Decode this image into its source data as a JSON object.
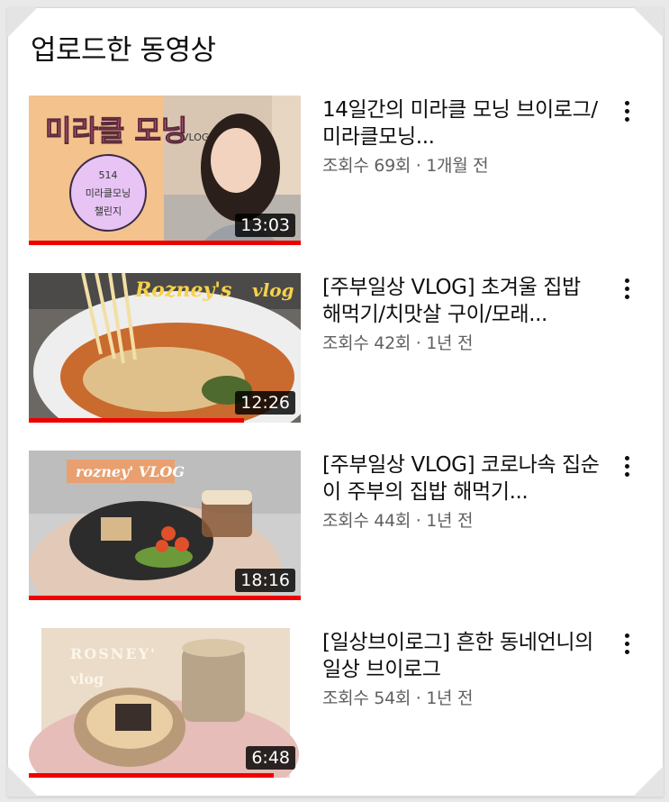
{
  "section": {
    "title": "업로드한 동영상"
  },
  "colors": {
    "progress": "#ee0000",
    "text": "#0f0f0f",
    "meta": "#606060"
  },
  "videos": [
    {
      "title": "14일간의 미라클 모닝 브이로그/미라클모닝...",
      "meta": "조회수 69회 · 1개월 전",
      "duration": "13:03",
      "watched": 1.0,
      "thumb_text": {
        "main": "미라클 모닝",
        "vlog": "VLOG",
        "circle1": "514",
        "circle2": "미라클모닝",
        "circle3": "챌린지"
      }
    },
    {
      "title": "[주부일상 VLOG] 초겨울 집밥 해먹기/치맛살 구이/모래...",
      "meta": "조회수 42회 · 1년 전",
      "duration": "12:26",
      "watched": 0.79,
      "thumb_text": {
        "main": "Rozney's",
        "vlog": "vlog"
      }
    },
    {
      "title": "[주부일상 VLOG] 코로나속 집순이 주부의 집밥 해먹기...",
      "meta": "조회수 44회 · 1년 전",
      "duration": "18:16",
      "watched": 1.0,
      "thumb_text": {
        "main": "rozney' VLOG"
      }
    },
    {
      "title": "[일상브이로그] 흔한 동네언니의 일상 브이로그",
      "meta": "조회수 54회 · 1년 전",
      "duration": "6:48",
      "watched": 0.9,
      "thumb_text": {
        "main": "ROSNEY'",
        "vlog": "vlog"
      }
    }
  ]
}
